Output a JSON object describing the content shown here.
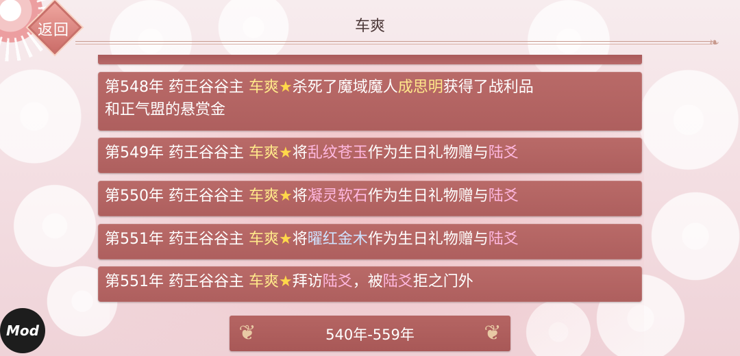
{
  "header": {
    "back_label": "返回",
    "title": "车爽"
  },
  "entries": [
    {
      "line1": [
        "第548年 药王谷谷主 ",
        "车爽",
        "★",
        "杀死了魔域魔人",
        "成思明",
        "获得了战利品"
      ],
      "line2": "和正气盟的悬赏金"
    },
    {
      "parts": [
        "第549年 药王谷谷主 ",
        "车爽",
        "★",
        "将",
        "乱纹苍玉",
        "作为生日礼物赠与",
        "陆爻"
      ]
    },
    {
      "parts": [
        "第550年 药王谷谷主 ",
        "车爽",
        "★",
        "将",
        "凝灵软石",
        "作为生日礼物赠与",
        "陆爻"
      ]
    },
    {
      "parts": [
        "第551年 药王谷谷主 ",
        "车爽",
        "★",
        "将",
        "曜红金木",
        "作为生日礼物赠与",
        "陆爻"
      ]
    },
    {
      "parts": [
        "第551年 药王谷谷主 ",
        "车爽",
        "★",
        "拜访",
        "陆爻",
        "，被",
        "陆爻",
        "拒之门外"
      ]
    }
  ],
  "pager": {
    "label": "540年-559年"
  },
  "mod_badge": "Mod",
  "colors": {
    "entry_bg": "#b3635f",
    "highlight_yellow": "#ffe88a",
    "highlight_pink": "#ffb8e0",
    "highlight_blue": "#cfe2ff",
    "star": "#ffd84a"
  }
}
